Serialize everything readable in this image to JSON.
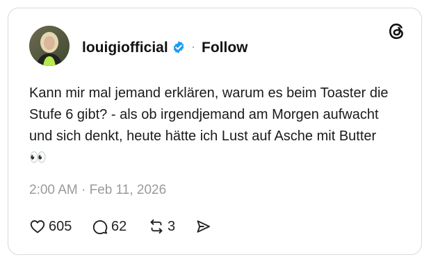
{
  "post": {
    "username": "louigiofficial",
    "follow_label": "Follow",
    "separator": "·",
    "text": "Kann mir mal jemand erklären, warum es beim Toaster die Stufe 6 gibt? - als ob irgendjemand am Morgen aufwacht und sich denkt, heute hätte ich Lust auf Asche mit Butter 👀",
    "timestamp": "2:00 AM · Feb 11, 2026"
  },
  "actions": {
    "likes": "605",
    "replies": "62",
    "reposts": "3"
  },
  "icons": {
    "logo": "threads-icon",
    "verified": "verified-badge-icon",
    "like": "heart-icon",
    "reply": "reply-bubble-icon",
    "repost": "repost-icon",
    "share": "share-icon"
  },
  "colors": {
    "verified_blue": "#1d9bf0",
    "text": "#1a1a1a",
    "muted": "#9a9a9a",
    "border": "#d9d9d9"
  }
}
